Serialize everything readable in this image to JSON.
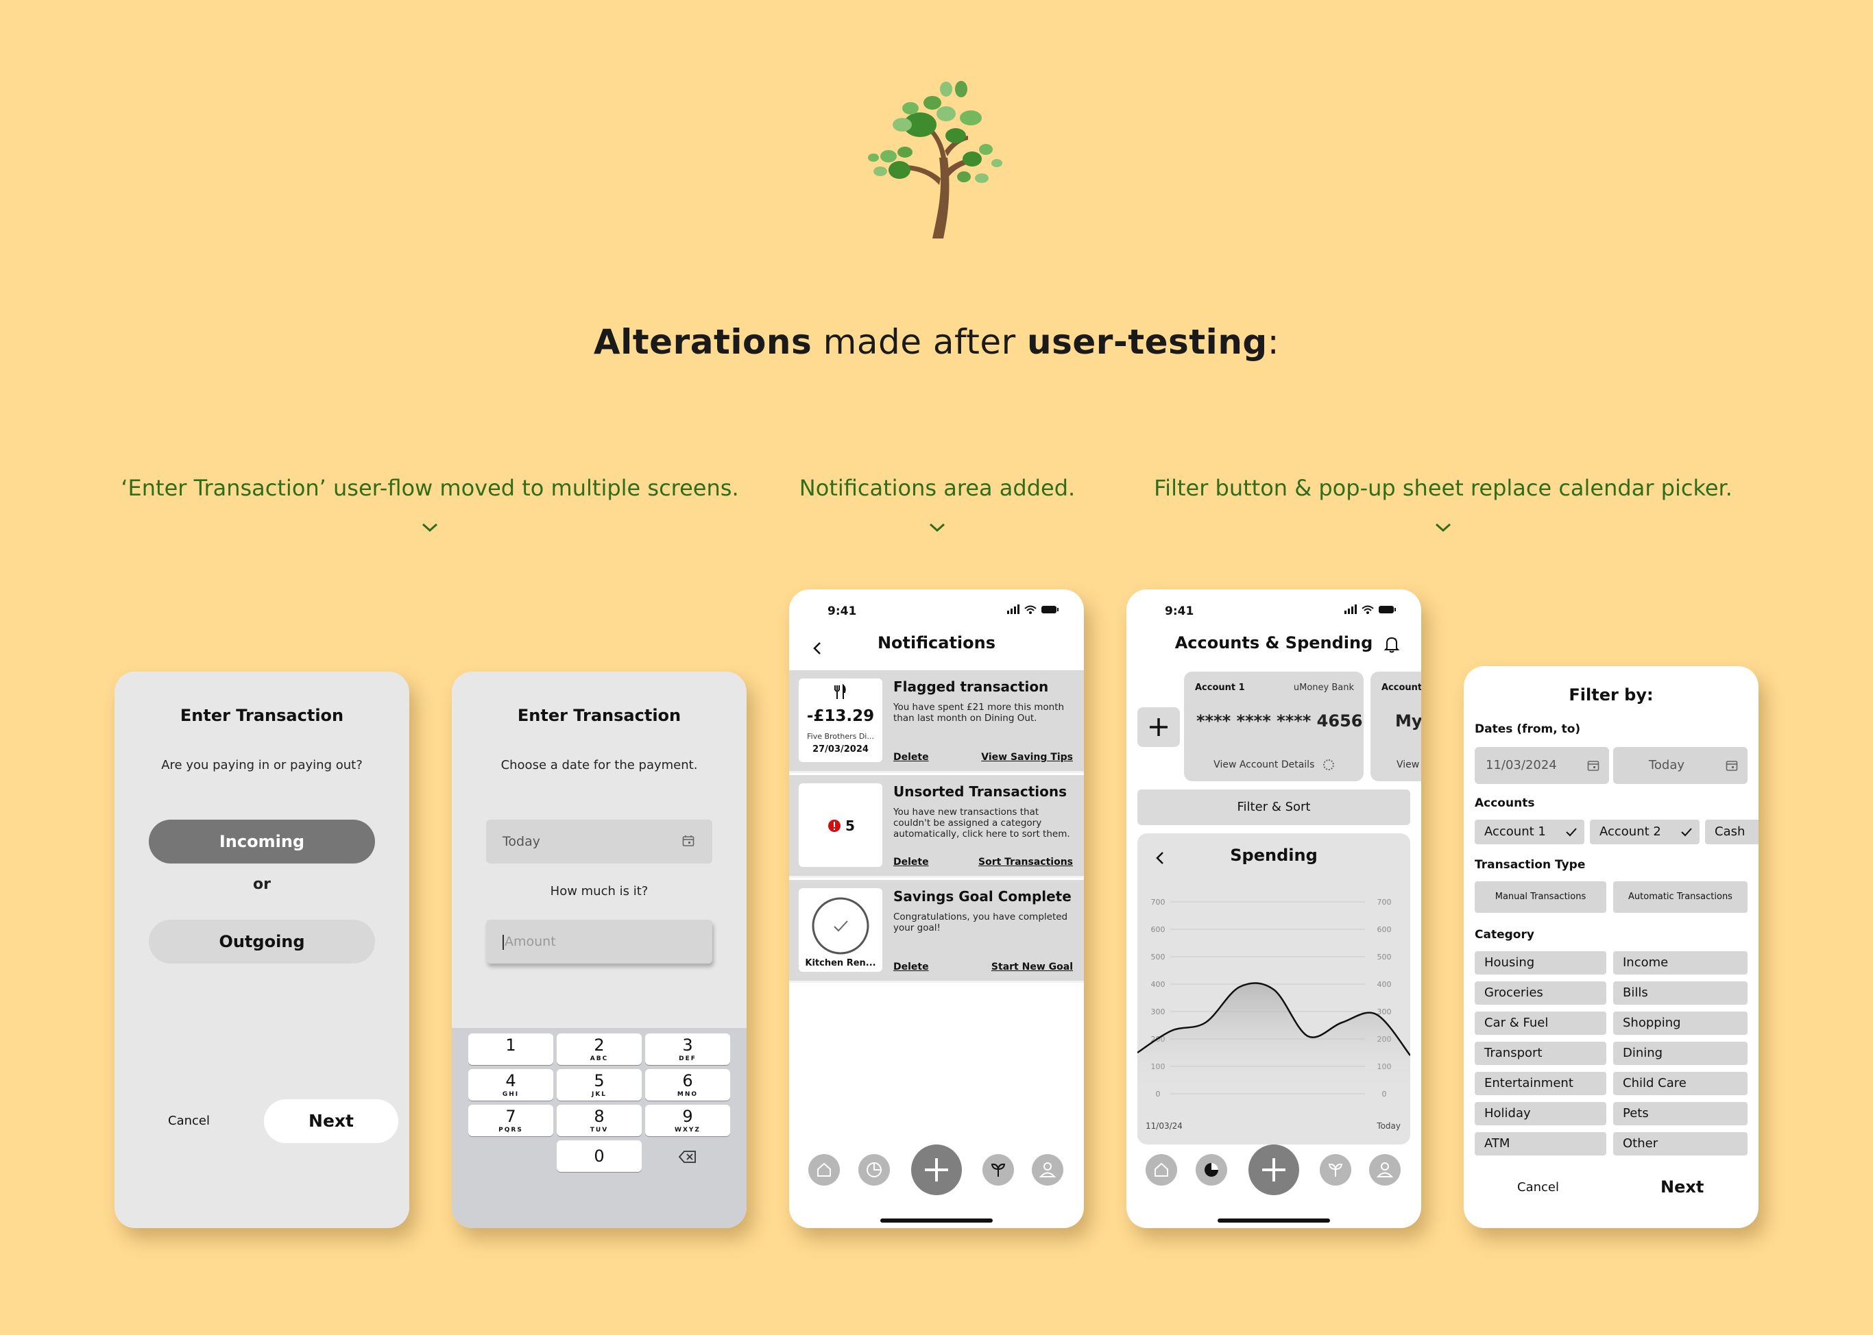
{
  "headline": {
    "part1": "Alterations",
    "part2": " made after ",
    "part3": "user-testing",
    "part4": ":"
  },
  "captions": [
    "‘Enter Transaction’ user-flow moved to multiple screens.",
    "Notifications area added.",
    "Filter button & pop-up sheet replace calendar picker."
  ],
  "screen1": {
    "title": "Enter Transaction",
    "question": "Are you paying in or paying out?",
    "incoming": "Incoming",
    "or": "or",
    "outgoing": "Outgoing",
    "cancel": "Cancel",
    "next": "Next"
  },
  "screen2": {
    "title": "Enter Transaction",
    "prompt": "Choose a date for the payment.",
    "date_value": "Today",
    "amount_prompt": "How much is it?",
    "amount_placeholder": "Amount",
    "keys": [
      {
        "n": "1",
        "l": ""
      },
      {
        "n": "2",
        "l": "ABC"
      },
      {
        "n": "3",
        "l": "DEF"
      },
      {
        "n": "4",
        "l": "GHI"
      },
      {
        "n": "5",
        "l": "JKL"
      },
      {
        "n": "6",
        "l": "MNO"
      },
      {
        "n": "7",
        "l": "PQRS"
      },
      {
        "n": "8",
        "l": "TUV"
      },
      {
        "n": "9",
        "l": "WXYZ"
      },
      {
        "n": "0",
        "l": ""
      }
    ]
  },
  "screen3": {
    "time": "9:41",
    "title": "Notifications",
    "items": [
      {
        "title": "Flagged transaction",
        "body": "You have spent £21 more this month than last month on Dining Out.",
        "amount": "-£13.29",
        "merchant": "Five Brothers Di...",
        "date": "27/03/2024",
        "action1": "Delete",
        "action2": "View Saving Tips"
      },
      {
        "title": "Unsorted Transactions",
        "body": "You have new transactions that couldn't be assigned a category automatically, click here to sort them.",
        "count": "5",
        "action1": "Delete",
        "action2": "Sort Transactions"
      },
      {
        "title": "Savings Goal Complete",
        "body": "Congratulations, you have completed your goal!",
        "goal": "Kitchen Ren...",
        "action1": "Delete",
        "action2": "Start New Goal"
      }
    ]
  },
  "screen4": {
    "time": "9:41",
    "title": "Accounts & Spending",
    "account1": {
      "name": "Account 1",
      "bank": "uMoney Bank",
      "number": "**** **** **** 4656",
      "details": "View Account Details"
    },
    "account2": {
      "name": "Account",
      "number": "My",
      "details": "View"
    },
    "filter_sort": "Filter & Sort",
    "chart_title": "Spending",
    "x_start": "11/03/24",
    "x_end": "Today"
  },
  "screen5": {
    "title": "Filter by:",
    "dates_label": "Dates (from, to)",
    "date_from": "11/03/2024",
    "date_to": "Today",
    "accounts_label": "Accounts",
    "accounts": [
      "Account 1",
      "Account 2",
      "Cash"
    ],
    "type_label": "Transaction Type",
    "types": [
      "Manual Transactions",
      "Automatic Transactions"
    ],
    "category_label": "Category",
    "categories": [
      "Housing",
      "Income",
      "Groceries",
      "Bills",
      "Car & Fuel",
      "Shopping",
      "Transport",
      "Dining",
      "Entertainment",
      "Child Care",
      "Holiday",
      "Pets",
      "ATM",
      "Other"
    ],
    "cancel": "Cancel",
    "next": "Next"
  },
  "chart_data": {
    "type": "area",
    "title": "Spending",
    "x": [
      "11/03/24",
      "",
      "",
      "",
      "",
      "",
      "",
      "",
      "Today"
    ],
    "values": [
      150,
      230,
      260,
      390,
      380,
      210,
      260,
      290,
      140
    ],
    "ylim": [
      0,
      700
    ],
    "yticks": [
      0,
      100,
      200,
      300,
      400,
      500,
      600,
      700
    ],
    "grid": true
  }
}
